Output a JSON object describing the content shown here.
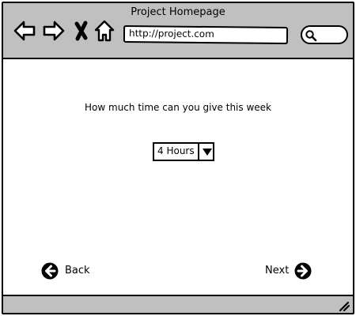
{
  "window": {
    "title": "Project Homepage"
  },
  "toolbar": {
    "back_icon": "back-arrow-icon",
    "forward_icon": "forward-arrow-icon",
    "stop_icon": "close-x-icon",
    "home_icon": "home-icon",
    "url": "http://project.com",
    "search_icon": "search-icon"
  },
  "main": {
    "question": "How much time can you give this week",
    "time_select": {
      "selected": "4 Hours",
      "icon": "chevron-down-icon"
    },
    "back_button": {
      "label": "Back",
      "icon": "arrow-left-circle-icon"
    },
    "next_button": {
      "label": "Next",
      "icon": "arrow-right-circle-icon"
    }
  },
  "statusbar": {
    "resize_icon": "resize-grip-icon"
  },
  "colors": {
    "chrome": "#c0c0c0",
    "ink": "#000000",
    "background": "#ffffff"
  }
}
